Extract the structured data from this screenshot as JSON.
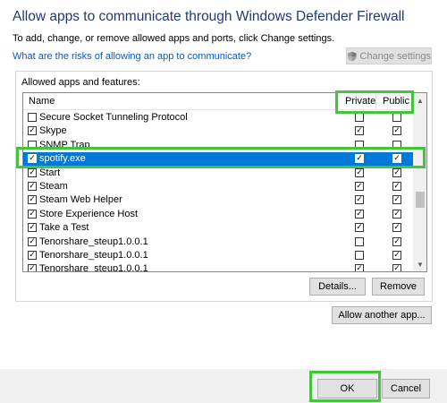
{
  "header": {
    "title": "Allow apps to communicate through Windows Defender Firewall",
    "subtitle": "To add, change, or remove allowed apps and ports, click Change settings.",
    "link": "What are the risks of allowing an app to communicate?",
    "change_settings_label": "Change settings"
  },
  "group_label": "Allowed apps and features:",
  "columns": {
    "name": "Name",
    "private": "Private",
    "public": "Public"
  },
  "apps": [
    {
      "name": "Secure Socket Tunneling Protocol",
      "enabled": "☐",
      "private": "☐",
      "public": "☐"
    },
    {
      "name": "Skype",
      "enabled": "☑",
      "private": "☑",
      "public": "☑"
    },
    {
      "name": "SNMP Trap",
      "enabled": "☐",
      "private": "☐",
      "public": "☐"
    },
    {
      "name": "spotify.exe",
      "enabled": "☑",
      "private": "☑",
      "public": "☑",
      "selected": true
    },
    {
      "name": "Start",
      "enabled": "☑",
      "private": "☑",
      "public": "☑"
    },
    {
      "name": "Steam",
      "enabled": "☑",
      "private": "☑",
      "public": "☑"
    },
    {
      "name": "Steam Web Helper",
      "enabled": "☑",
      "private": "☑",
      "public": "☑"
    },
    {
      "name": "Store Experience Host",
      "enabled": "☑",
      "private": "☑",
      "public": "☑"
    },
    {
      "name": "Take a Test",
      "enabled": "☑",
      "private": "☑",
      "public": "☑"
    },
    {
      "name": "Tenorshare_steup1.0.0.1",
      "enabled": "☑",
      "private": "☐",
      "public": "☑"
    },
    {
      "name": "Tenorshare_steup1.0.0.1",
      "enabled": "☑",
      "private": "☐",
      "public": "☑"
    },
    {
      "name": "Tenorshare_steup1.0.0.1",
      "enabled": "☑",
      "private": "☑",
      "public": "☑"
    }
  ],
  "buttons": {
    "details": "Details...",
    "remove": "Remove",
    "allow_another": "Allow another app...",
    "ok": "OK",
    "cancel": "Cancel"
  },
  "icons": {
    "shield": "shield-icon",
    "scroll_up": "▲",
    "scroll_down": "▼"
  },
  "colors": {
    "highlight": "#44c43d",
    "selection": "#0078d7",
    "title": "#1f3a70",
    "link": "#0a58c8"
  }
}
